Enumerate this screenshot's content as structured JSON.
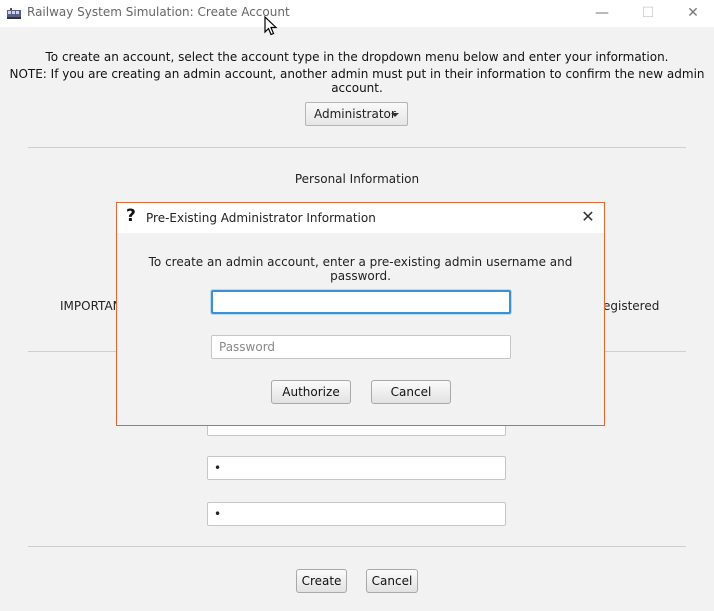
{
  "window": {
    "title": "Railway System Simulation: Create Account",
    "controls": {
      "minimize": "—",
      "maximize": "☐",
      "close": "✕"
    }
  },
  "intro": {
    "line1": "To create an account, select the account type in the dropdown menu below and enter your information.",
    "line2": "NOTE: If you are creating an admin account, another admin must put in their information to confirm the new admin account."
  },
  "account_type": {
    "selected": "Administrator"
  },
  "personal_info": {
    "heading": "Personal Information"
  },
  "background_text": {
    "important_fragment": "IMPORTAN",
    "registered_fragment": "egistered"
  },
  "fields": [
    {
      "value": "•"
    },
    {
      "value": "•"
    }
  ],
  "buttons": {
    "create": "Create",
    "cancel": "Cancel"
  },
  "dialog": {
    "title": "Pre-Existing Administrator Information",
    "message": "To create an admin account, enter a pre-existing admin username and password.",
    "username": {
      "value": "",
      "placeholder": ""
    },
    "password": {
      "value": "",
      "placeholder": "Password"
    },
    "authorize_label": "Authorize",
    "cancel_label": "Cancel"
  }
}
